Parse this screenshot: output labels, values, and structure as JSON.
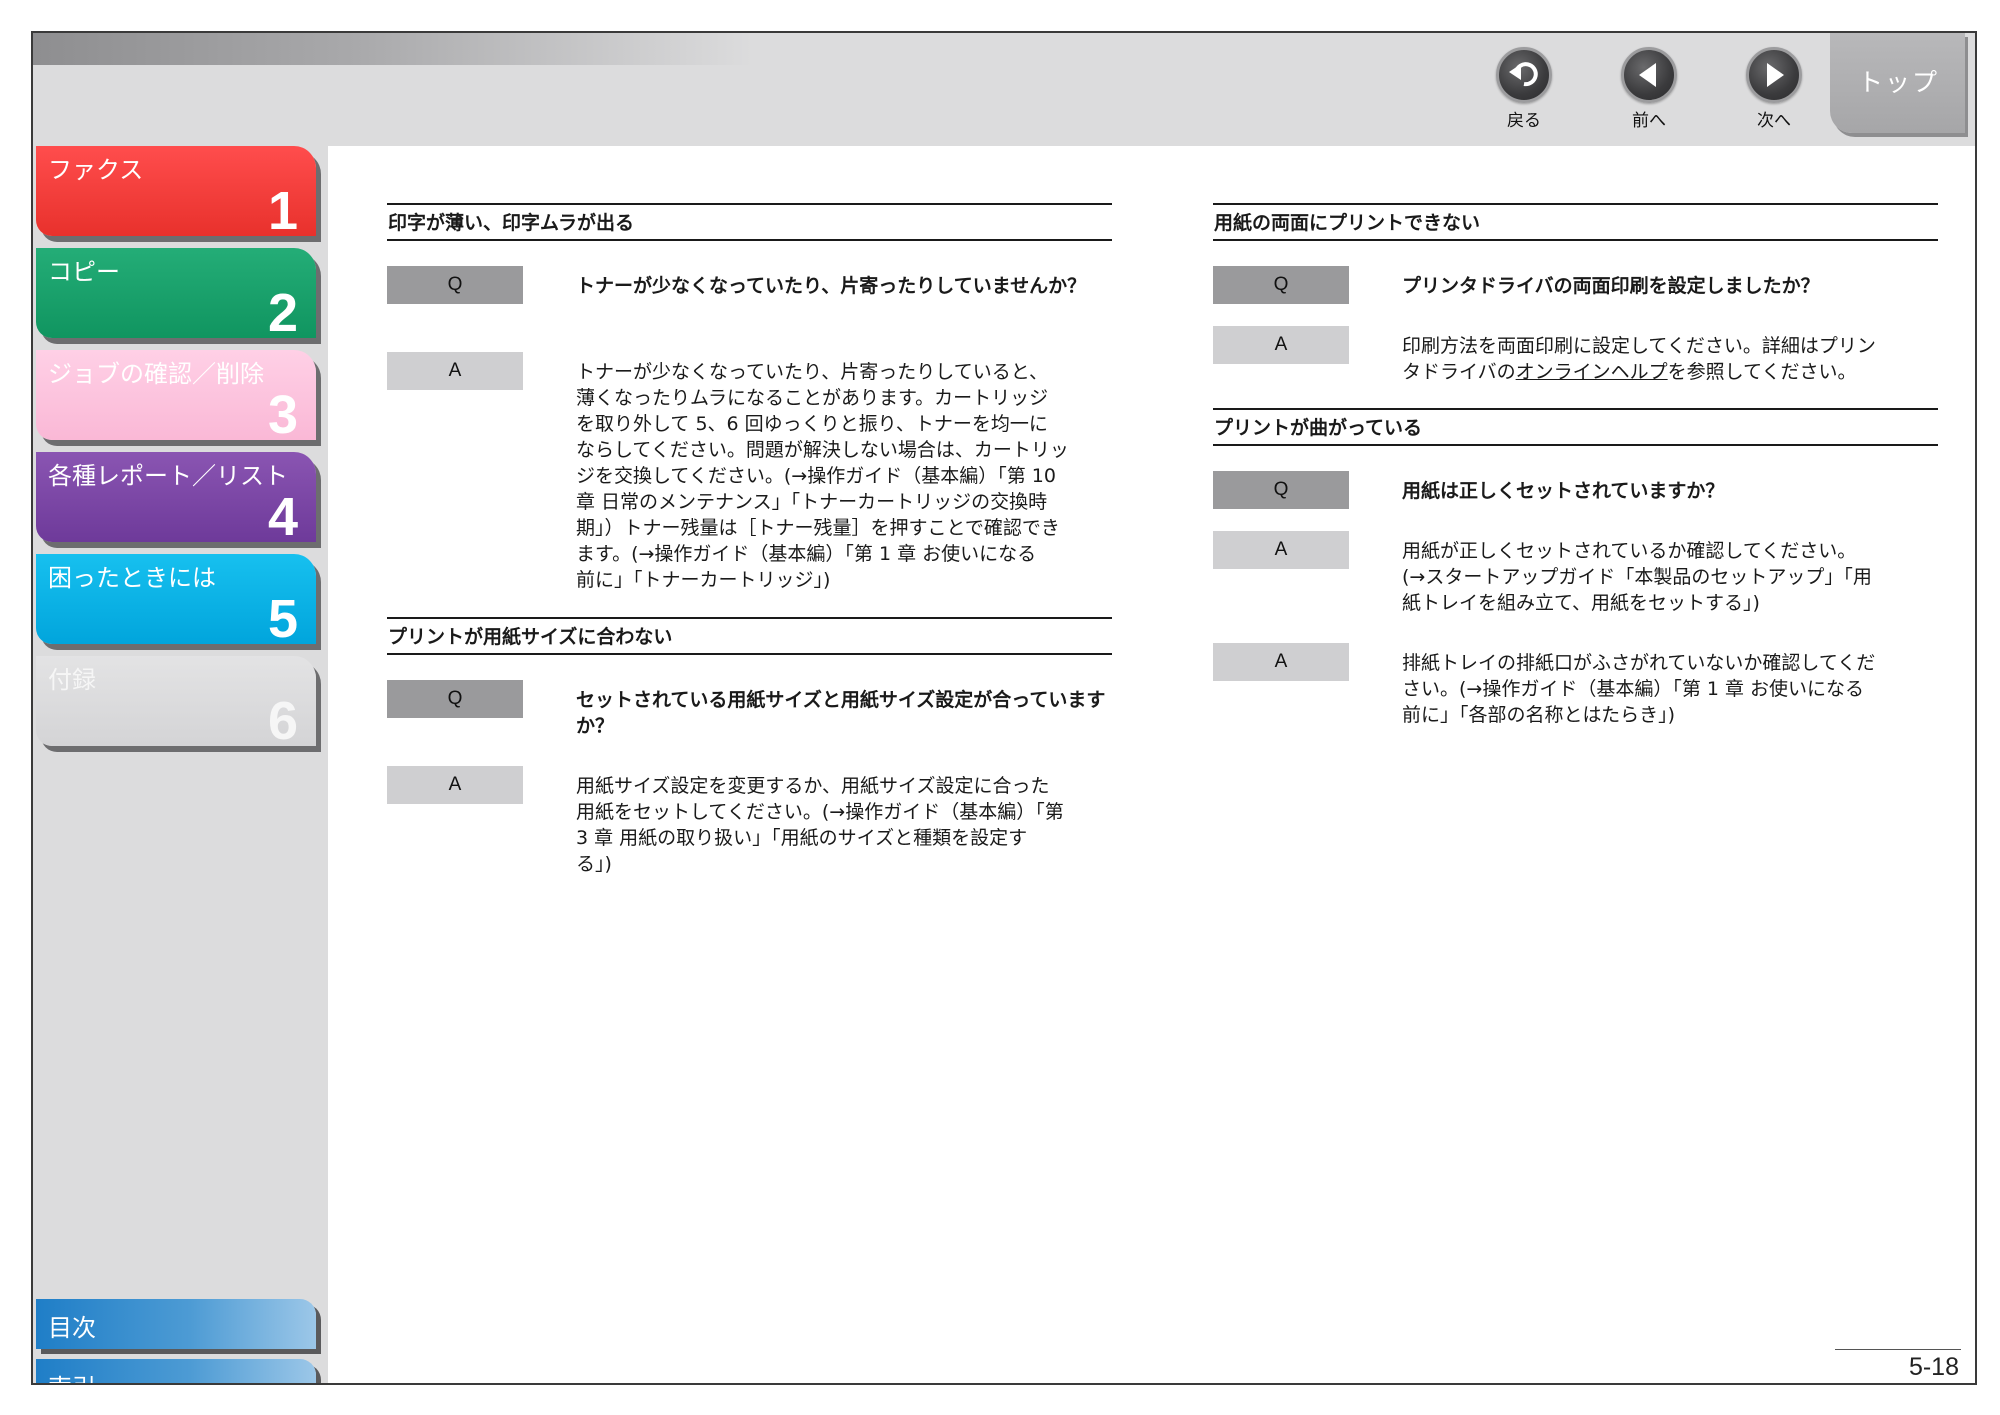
{
  "nav": {
    "back_label": "戻る",
    "prev_label": "前へ",
    "next_label": "次へ",
    "top_label": "トップ"
  },
  "sidebar": {
    "chapters": [
      {
        "title": "ファクス",
        "number": "1",
        "color": "#ef3b35"
      },
      {
        "title": "コピー",
        "number": "2",
        "color": "#16a06b"
      },
      {
        "title": "ジョブの確認／削除",
        "number": "3",
        "color": "#fbc2dd"
      },
      {
        "title": "各種レポート／リスト",
        "number": "4",
        "color": "#7a46a5"
      },
      {
        "title": "困ったときには",
        "number": "5",
        "color": "#0ab3e6"
      },
      {
        "title": "付録",
        "number": "6",
        "color": "#dcdcdd"
      }
    ],
    "toc_label": "目次",
    "index_label": "索引"
  },
  "content": {
    "q_tag": "Q",
    "a_tag": "A",
    "sections": [
      {
        "heading": "印字が薄い、印字ムラが出る",
        "question": "トナーが少なくなっていたり、片寄ったりしていませんか？",
        "answers": [
          [
            "トナーが少なくなっていたり、片寄ったりしていると、",
            "薄くなったりムラになることがあります。カートリッジ",
            "を取り外して 5、6 回ゆっくりと振り、トナーを均一に",
            "ならしてください。問題が解決しない場合は、カートリッ",
            "ジを交換してください。(→操作ガイド（基本編）「第 10",
            "章 日常のメンテナンス」「トナーカートリッジの交換時",
            "期」）トナー残量は［トナー残量］を押すことで確認でき",
            "ます。(→操作ガイド（基本編）「第 1 章 お使いになる",
            "前に」「トナーカートリッジ」)"
          ]
        ]
      },
      {
        "heading": "プリントが用紙サイズに合わない",
        "question": "セットされている用紙サイズと用紙サイズ設定が合っていますか？",
        "answers": [
          [
            "用紙サイズ設定を変更するか、用紙サイズ設定に合った",
            "用紙をセットしてください。(→操作ガイド（基本編）「第",
            "3 章 用紙の取り扱い」「用紙のサイズと種類を設定す",
            "る」)"
          ]
        ]
      },
      {
        "heading": "用紙の両面にプリントできない",
        "question": "プリンタドライバの両面印刷を設定しましたか？",
        "answer_pre": "印刷方法を両面印刷に設定してください。詳細はプリン",
        "answer_line2_a": "タドライバの",
        "answer_link": "オンラインヘルプ",
        "answer_line2_b": "を参照してください。"
      },
      {
        "heading": "プリントが曲がっている",
        "question": "用紙は正しくセットされていますか？",
        "answers": [
          [
            "用紙が正しくセットされているか確認してください。",
            "(→スタートアップガイド「本製品のセットアップ」「用",
            "紙トレイを組み立て、用紙をセットする」)"
          ],
          [
            "排紙トレイの排紙口がふさがれていないか確認してくだ",
            "さい。(→操作ガイド（基本編）「第 1 章 お使いになる",
            "前に」「各部の名称とはたらき」)"
          ]
        ]
      }
    ]
  },
  "page_number": "5-18"
}
